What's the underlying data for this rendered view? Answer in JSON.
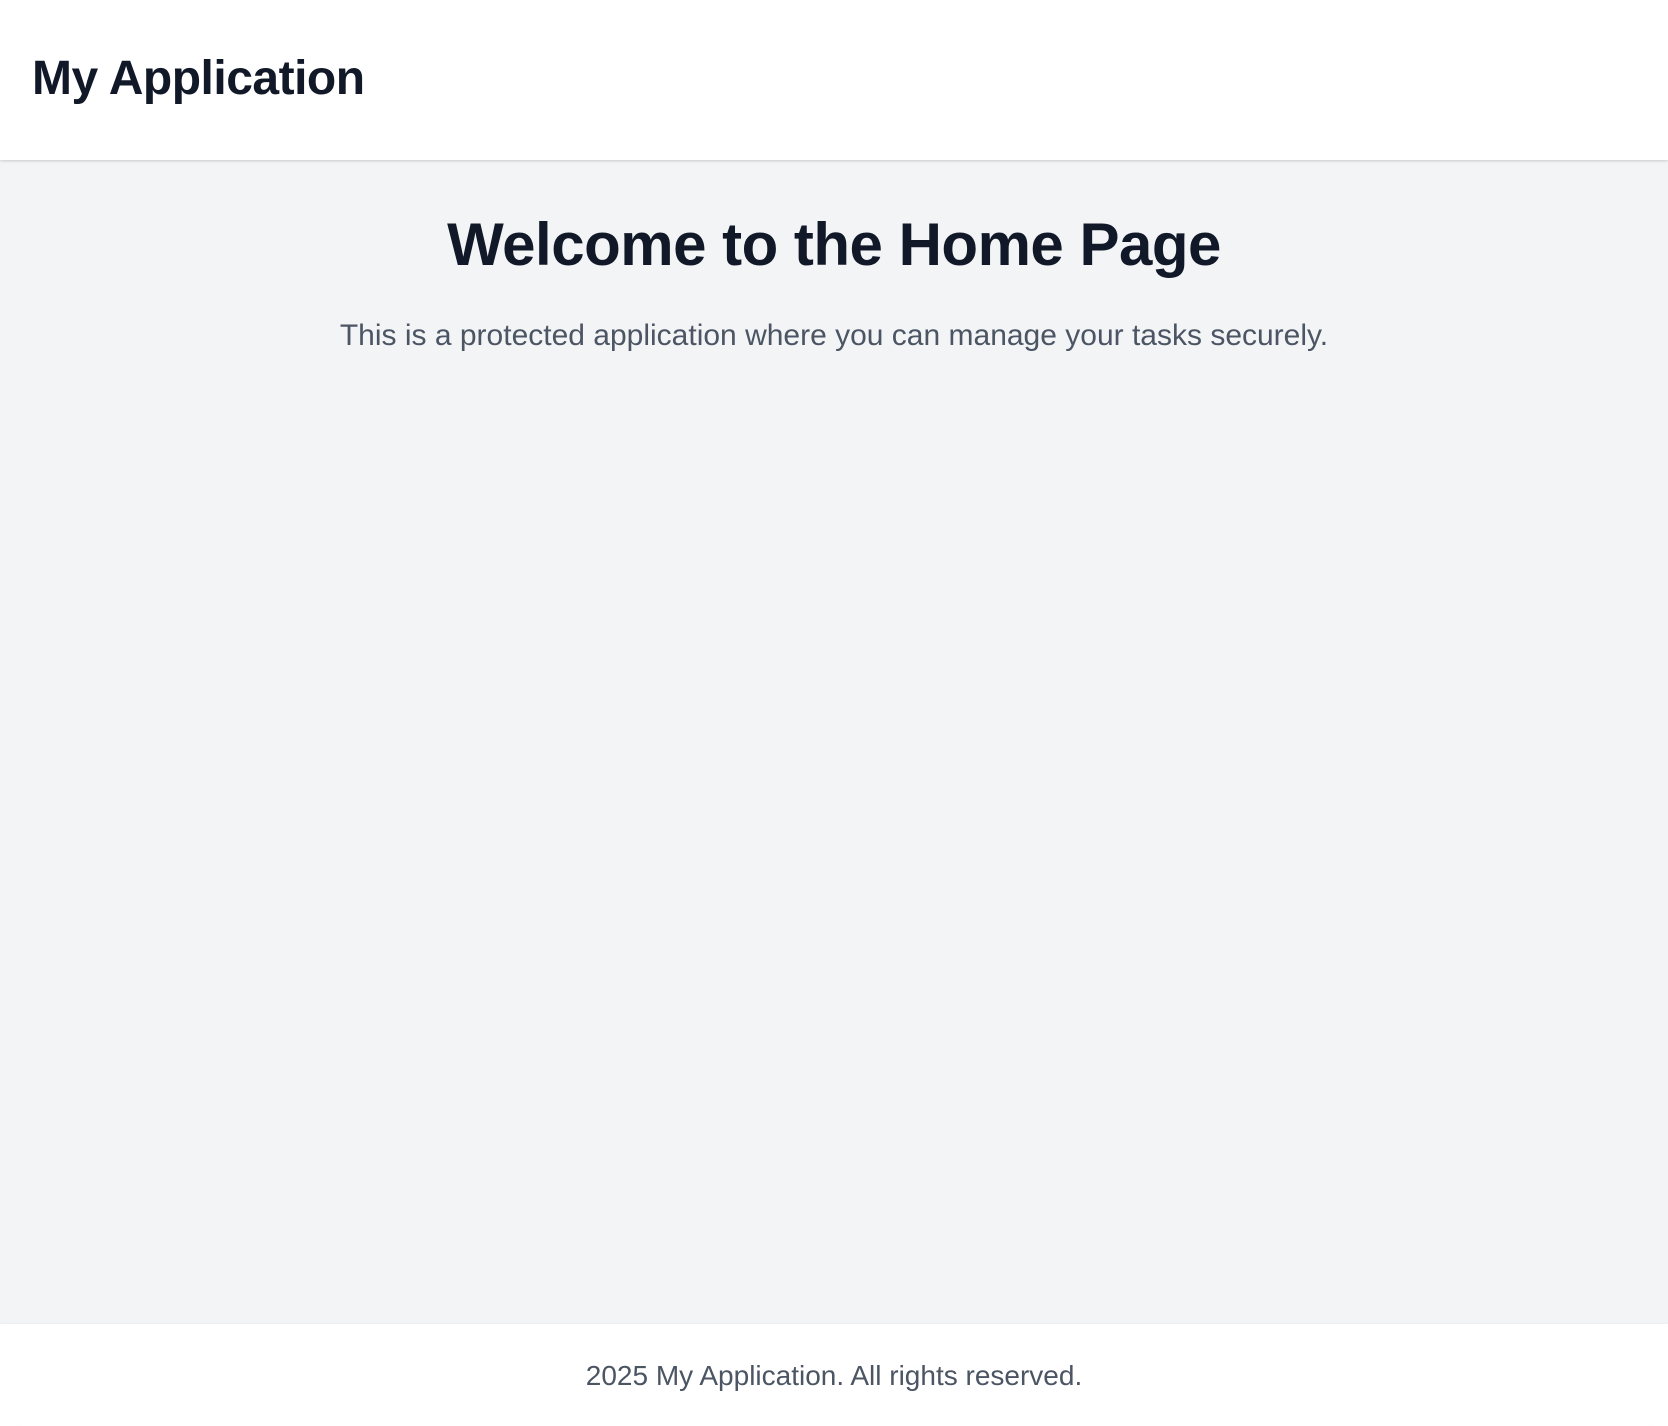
{
  "header": {
    "title": "My Application"
  },
  "main": {
    "title": "Welcome to the Home Page",
    "subtitle": "This is a protected application where you can manage your tasks securely."
  },
  "footer": {
    "copyright": "2025 My Application. All rights reserved."
  },
  "colors": {
    "header_background": "#ffffff",
    "page_background": "#f3f4f6",
    "title_text": "#111827",
    "body_text": "#4b5563"
  }
}
